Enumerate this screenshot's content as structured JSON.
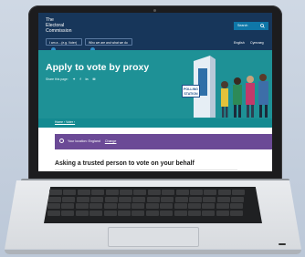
{
  "header": {
    "logo_lines": [
      "The",
      "Electoral",
      "Commission"
    ],
    "nav_items": [
      "I am a ...(e.g. Voter)",
      "Who we are and what we do"
    ],
    "search_label": "Search",
    "languages": [
      "English",
      "Cymraeg"
    ]
  },
  "hero": {
    "title": "Apply to vote by proxy",
    "share_label": "Share this page:",
    "share_icons": [
      "twitter-icon",
      "facebook-icon",
      "linkedin-icon",
      "email-icon"
    ],
    "sign_lines": [
      "POLLING",
      "STATION"
    ]
  },
  "breadcrumb": [
    "Home",
    "Voter"
  ],
  "location": {
    "label": "Your location: England",
    "change_label": "Change"
  },
  "content": {
    "subheading": "Asking a trusted person to vote on your behalf"
  },
  "colors": {
    "header_bg": "#17365a",
    "hero_bg": "#1e9196",
    "location_bg": "#6b4a96",
    "search_bg": "#0f77a8"
  }
}
